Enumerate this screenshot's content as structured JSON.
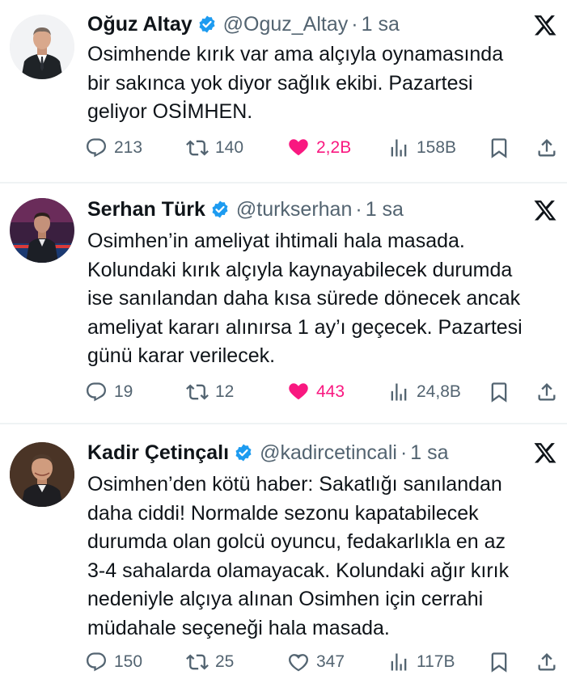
{
  "colors": {
    "verified": "#1d9bf0",
    "liked": "#f91880",
    "muted": "#536471",
    "text": "#0f1419"
  },
  "tweets": [
    {
      "name": "Oğuz Altay",
      "handle": "@Oguz_Altay",
      "separator": "·",
      "time": "1 sa",
      "text": "Osimhende kırık var ama alçıyla oynamasında\nbir sakınca yok diyor sağlık ekibi.  Pazartesi\ngeliyor OSİMHEN.",
      "replies": "213",
      "retweets": "140",
      "likes": "2,2B",
      "views": "158B",
      "liked": true,
      "avatar_icon": "man-in-suit-avatar"
    },
    {
      "name": "Serhan Türk",
      "handle": "@turkserhan",
      "separator": "·",
      "time": "1 sa",
      "text": "Osimhen’in ameliyat ihtimali hala masada.\nKolundaki kırık alçıyla kaynayabilecek durumda\nise sanılandan daha kısa sürede dönecek ancak\nameliyat kararı alınırsa 1 ay’ı geçecek. Pazartesi\ngünü karar verilecek.",
      "replies": "19",
      "retweets": "12",
      "likes": "443",
      "views": "24,8B",
      "liked": true,
      "avatar_icon": "tv-studio-avatar"
    },
    {
      "name": "Kadir Çetinçalı",
      "handle": "@kadircetincali",
      "separator": "·",
      "time": "1 sa",
      "text": "Osimhen’den kötü haber: Sakatlığı sanılandan\ndaha ciddi! Normalde sezonu kapatabilecek\ndurumda olan golcü oyuncu, fedakarlıkla en az\n3-4 sahalarda olamayacak. Kolundaki ağır kırık\nnedeniyle alçıya alınan Osimhen için cerrahi\nmüdahale seçeneği hala masada.",
      "replies": "150",
      "retweets": "25",
      "likes": "347",
      "views": "117B",
      "liked": false,
      "avatar_icon": "portrait-avatar"
    }
  ]
}
